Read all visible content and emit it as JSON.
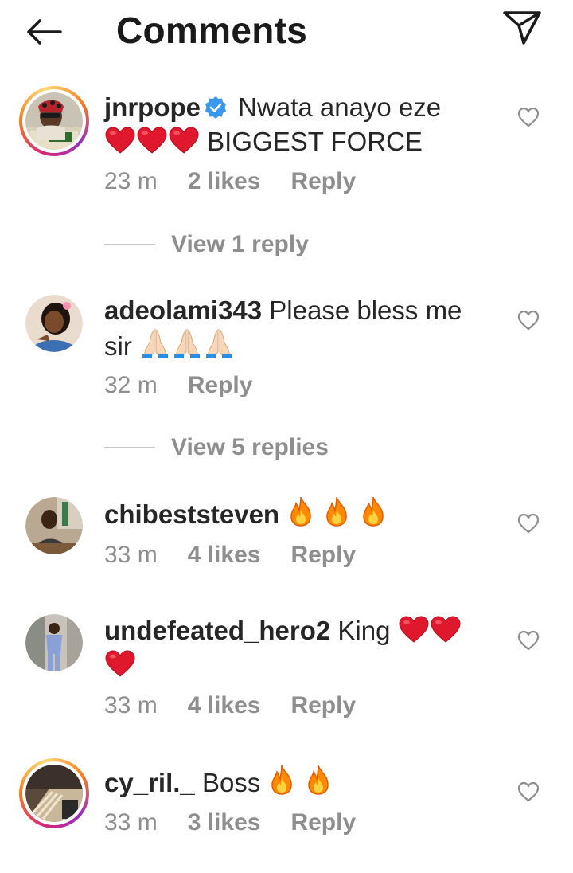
{
  "header": {
    "title": "Comments"
  },
  "comments": [
    {
      "username": "jnrpope",
      "verified": true,
      "text": "Nwata anayo eze",
      "line2": "BIGGEST FORCE",
      "time": "23 m",
      "likes": "2 likes",
      "reply": "Reply",
      "view_replies": "View 1 reply"
    },
    {
      "username": "adeolami343",
      "text": "Please bless me",
      "line2": "sir",
      "time": "32 m",
      "reply": "Reply",
      "view_replies": "View 5 replies"
    },
    {
      "username": "chibeststeven",
      "text": "",
      "time": "33 m",
      "likes": "4 likes",
      "reply": "Reply"
    },
    {
      "username": "undefeated_hero2",
      "text": "King",
      "time": "33 m",
      "likes": "4 likes",
      "reply": "Reply"
    },
    {
      "username": "cy_ril._",
      "text": "Boss",
      "time": "33 m",
      "likes": "3 likes",
      "reply": "Reply"
    }
  ],
  "icons": {
    "back": "arrow-left-icon",
    "send": "paper-plane-icon",
    "like": "heart-outline-icon",
    "verified": "verified-badge-icon",
    "emoji_heart": "red-heart-emoji",
    "emoji_pray": "folded-hands-emoji",
    "emoji_fire": "fire-emoji"
  },
  "colors": {
    "verified_blue": "#3897f0",
    "muted_text": "#8e8e8e",
    "text": "#262626"
  }
}
